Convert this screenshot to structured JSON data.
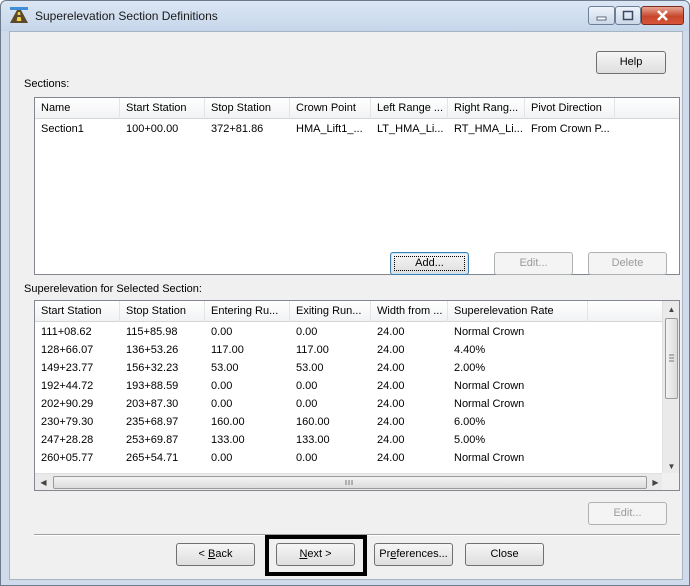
{
  "window": {
    "title": "Superelevation Section Definitions",
    "icon": "road-icon"
  },
  "help_label": "Help",
  "sections": {
    "label": "Sections:",
    "columns": [
      "Name",
      "Start Station",
      "Stop Station",
      "Crown Point",
      "Left Range ...",
      "Right Rang...",
      "Pivot Direction"
    ],
    "rows": [
      [
        "Section1",
        "100+00.00",
        "372+81.86",
        "HMA_Lift1_...",
        "LT_HMA_Li...",
        "RT_HMA_Li...",
        "From Crown P..."
      ]
    ]
  },
  "section_buttons": {
    "add": "Add...",
    "edit": "Edit...",
    "delete": "Delete"
  },
  "superelevation": {
    "label": "Superelevation for Selected Section:",
    "columns": [
      "Start Station",
      "Stop Station",
      "Entering Ru...",
      "Exiting Run...",
      "Width from ...",
      "Superelevation Rate"
    ],
    "rows": [
      [
        "111+08.62",
        "115+85.98",
        "0.00",
        "0.00",
        "24.00",
        "Normal Crown"
      ],
      [
        "128+66.07",
        "136+53.26",
        "117.00",
        "117.00",
        "24.00",
        "4.40%"
      ],
      [
        "149+23.77",
        "156+32.23",
        "53.00",
        "53.00",
        "24.00",
        "2.00%"
      ],
      [
        "192+44.72",
        "193+88.59",
        "0.00",
        "0.00",
        "24.00",
        "Normal Crown"
      ],
      [
        "202+90.29",
        "203+87.30",
        "0.00",
        "0.00",
        "24.00",
        "Normal Crown"
      ],
      [
        "230+79.30",
        "235+68.97",
        "160.00",
        "160.00",
        "24.00",
        "6.00%"
      ],
      [
        "247+28.28",
        "253+69.87",
        "133.00",
        "133.00",
        "24.00",
        "5.00%"
      ],
      [
        "260+05.77",
        "265+54.71",
        "0.00",
        "0.00",
        "24.00",
        "Normal Crown"
      ]
    ],
    "edit": "Edit..."
  },
  "footer": {
    "back": "< Back",
    "next": "Next >",
    "preferences": "Preferences...",
    "close": "Close"
  },
  "colors": {
    "highlight": "#000000",
    "close_button": "#c6462c"
  }
}
